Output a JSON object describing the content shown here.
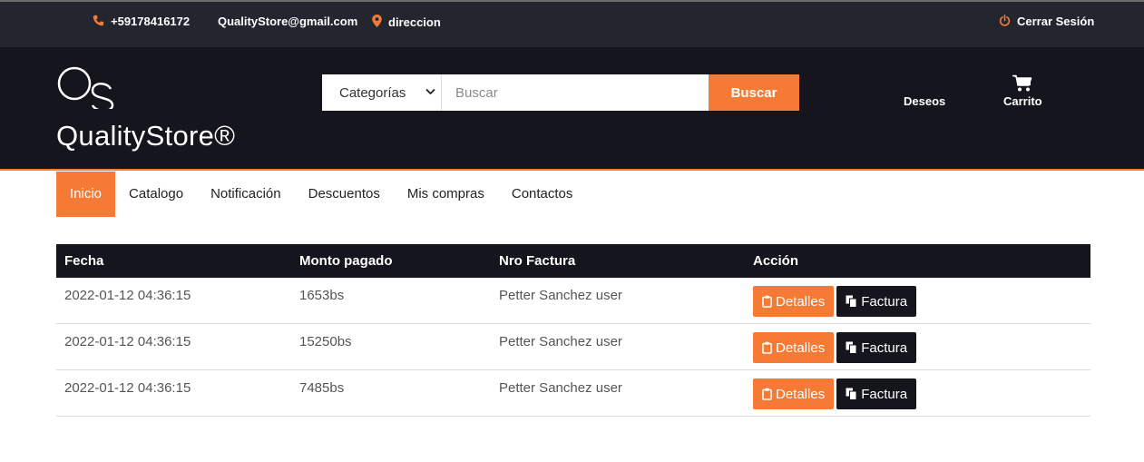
{
  "topbar": {
    "phone": "+59178416172",
    "email": "QualityStore@gmail.com",
    "address": "direccion",
    "logout": "Cerrar Sesión"
  },
  "header": {
    "brand": "QualityStore®",
    "categories_label": "Categorías",
    "search_placeholder": "Buscar",
    "search_button": "Buscar",
    "wishlist": "Deseos",
    "cart": "Carrito"
  },
  "nav": {
    "tabs": [
      "Inicio",
      "Catalogo",
      "Notificación",
      "Descuentos",
      "Mis compras",
      "Contactos"
    ],
    "active": "Inicio"
  },
  "table": {
    "columns": [
      "Fecha",
      "Monto pagado",
      "Nro Factura",
      "Acción"
    ],
    "rows": [
      {
        "fecha": "2022-01-12 04:36:15",
        "monto": "1653bs",
        "factura": "Petter Sanchez user"
      },
      {
        "fecha": "2022-01-12 04:36:15",
        "monto": "15250bs",
        "factura": "Petter Sanchez user"
      },
      {
        "fecha": "2022-01-12 04:36:15",
        "monto": "7485bs",
        "factura": "Petter Sanchez user"
      }
    ],
    "detalles_label": "Detalles",
    "factura_label": "Factura"
  },
  "colors": {
    "accent": "#f47a35",
    "dark": "#15161d",
    "topbar": "#23252f"
  }
}
